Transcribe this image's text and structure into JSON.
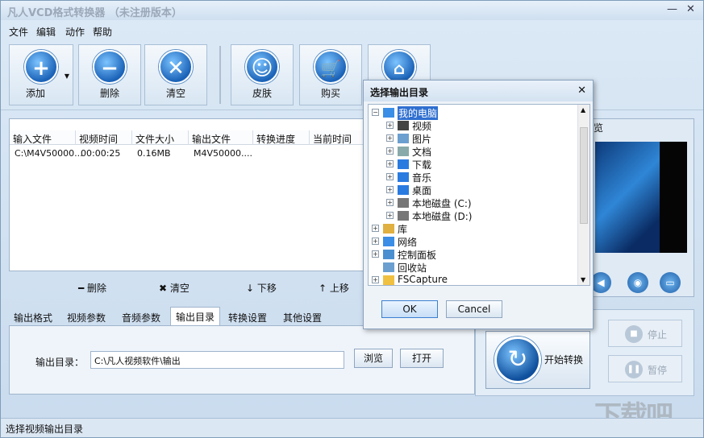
{
  "window": {
    "title": "凡人VCD格式转换器 （未注册版本）",
    "min": "—",
    "close": "✕"
  },
  "menu": [
    "文件",
    "编辑",
    "动作",
    "帮助"
  ],
  "toolbar": {
    "add": "添加",
    "delete": "删除",
    "clear": "清空",
    "skin": "皮肤",
    "buy": "购买",
    "home_icon": "home-icon"
  },
  "list": {
    "columns": [
      "输入文件",
      "视频时间",
      "文件大小",
      "输出文件",
      "转换进度",
      "当前时间"
    ],
    "rows": [
      [
        "C:\\M4V50000...",
        "00:00:25",
        "0.16MB",
        "M4V50000....",
        "",
        ""
      ]
    ]
  },
  "list_actions": {
    "delete": "删除",
    "clear": "清空",
    "down": "下移",
    "up": "上移"
  },
  "tabs": [
    "输出格式",
    "视频参数",
    "音频参数",
    "输出目录",
    "转换设置",
    "其他设置"
  ],
  "active_tab": "输出目录",
  "output": {
    "label": "输出目录：",
    "path": "C:\\凡人视频软件\\输出",
    "browse": "浏览",
    "open": "打开"
  },
  "preview": {
    "title_fragment": "览"
  },
  "convert": {
    "start": "开始转换",
    "stop": "停止",
    "pause": "暂停"
  },
  "status": "选择视频输出目录",
  "watermark": "下载吧",
  "dialog": {
    "title": "选择输出目录",
    "tree": [
      {
        "label": "我的电脑",
        "level": 0,
        "selected": true
      },
      {
        "label": "视频",
        "level": 1
      },
      {
        "label": "图片",
        "level": 1
      },
      {
        "label": "文档",
        "level": 1
      },
      {
        "label": "下载",
        "level": 1
      },
      {
        "label": "音乐",
        "level": 1
      },
      {
        "label": "桌面",
        "level": 1
      },
      {
        "label": "本地磁盘 (C:)",
        "level": 1
      },
      {
        "label": "本地磁盘 (D:)",
        "level": 1
      },
      {
        "label": "库",
        "level": 0
      },
      {
        "label": "网络",
        "level": 0
      },
      {
        "label": "控制面板",
        "level": 0
      },
      {
        "label": "回收站",
        "level": 0
      },
      {
        "label": "FSCapture",
        "level": 0
      }
    ],
    "ok": "OK",
    "cancel": "Cancel"
  }
}
